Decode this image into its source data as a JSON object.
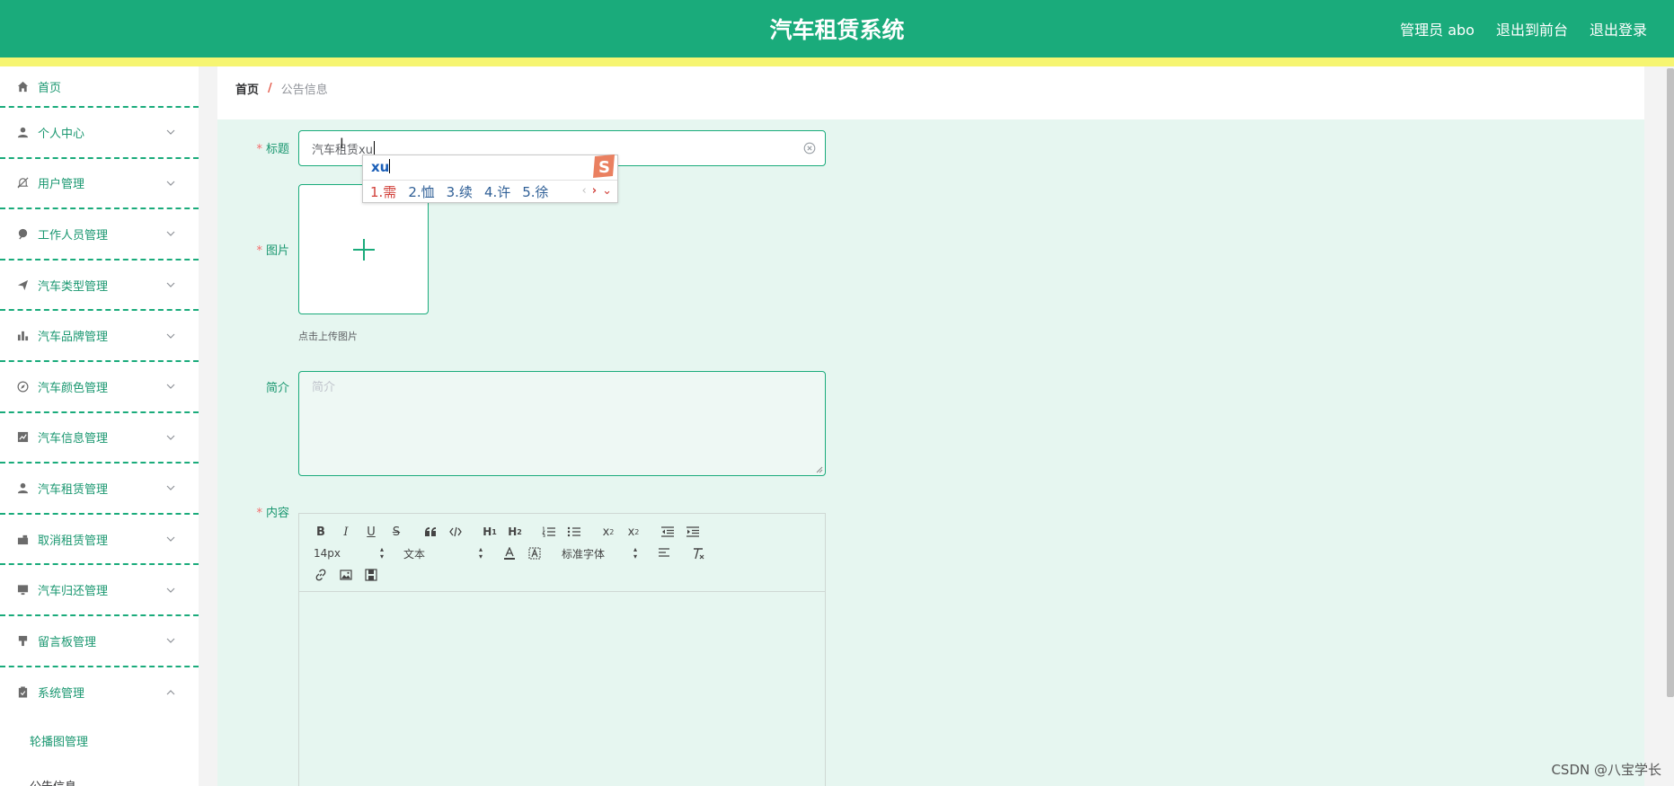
{
  "header": {
    "title": "汽车租赁系统",
    "admin": "管理员 abo",
    "to_front": "退出到前台",
    "logout": "退出登录",
    "bg_color": "#1aab7b",
    "strip_color": "#f6f571"
  },
  "sidebar": {
    "items": [
      {
        "label": "首页",
        "icon": "home-icon"
      },
      {
        "label": "个人中心",
        "icon": "user-icon"
      },
      {
        "label": "用户管理",
        "icon": "bell-off-icon"
      },
      {
        "label": "工作人员管理",
        "icon": "leaf-icon"
      },
      {
        "label": "汽车类型管理",
        "icon": "send-icon"
      },
      {
        "label": "汽车品牌管理",
        "icon": "bar-chart-icon"
      },
      {
        "label": "汽车颜色管理",
        "icon": "compass-icon"
      },
      {
        "label": "汽车信息管理",
        "icon": "trend-icon"
      },
      {
        "label": "汽车租赁管理",
        "icon": "user-icon"
      },
      {
        "label": "取消租赁管理",
        "icon": "camera-icon"
      },
      {
        "label": "汽车归还管理",
        "icon": "monitor-icon"
      },
      {
        "label": "留言板管理",
        "icon": "brush-icon"
      },
      {
        "label": "系统管理",
        "icon": "clipboard-icon"
      }
    ],
    "sub_items": [
      {
        "label": "轮播图管理"
      },
      {
        "label": "公告信息"
      }
    ]
  },
  "breadcrumb": {
    "home": "首页",
    "separator": "/",
    "current": "公告信息"
  },
  "form": {
    "title_label": "标题",
    "title_value": "汽车租赁xu",
    "image_label": "图片",
    "upload_tip": "点击上传图片",
    "intro_label": "简介",
    "intro_placeholder": "简介",
    "content_label": "内容",
    "required_mark": "*"
  },
  "editor": {
    "font_size": "14px",
    "header_select": "文本",
    "font_select": "标准字体"
  },
  "ime": {
    "input": "xu",
    "candidates": [
      "1.需",
      "2.恤",
      "3.续",
      "4.许",
      "5.徐"
    ]
  },
  "watermark": "CSDN @八宝学长"
}
